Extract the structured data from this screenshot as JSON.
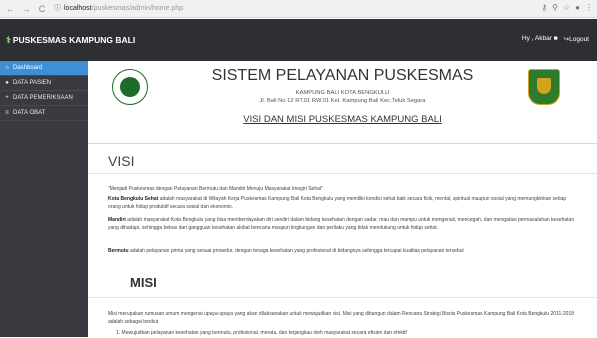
{
  "browser": {
    "url_host": "localhost",
    "url_path": "/puskesmas/admin/home.php"
  },
  "header": {
    "brand": "PUSKESMAS KAMPUNG BALI",
    "user": "Hy , Akbar",
    "logout": "Logout"
  },
  "sidebar": {
    "items": [
      {
        "label": "Dashboard",
        "icon": "home-icon"
      },
      {
        "label": "DATA PASIEN",
        "icon": "user-icon"
      },
      {
        "label": "DATA PEMERIKSAAN",
        "icon": "plus-icon"
      },
      {
        "label": "DATA OBAT",
        "icon": "list-icon"
      }
    ]
  },
  "main": {
    "title": "SISTEM PELAYANAN PUSKESMAS",
    "subtitle1": "KAMPUNG BALI KOTA BENGKULU",
    "subtitle2": "Jl. Bali No 12 RT.01 RW.01 Kel. Kampung Bali Kec.Teluk Segara",
    "visi_misi_title": "VISI DAN MISI PUSKESMAS KAMPUNG BALI",
    "visi_heading": "VISI",
    "visi_quote": "\"Menjadi Puskesmas dengan Pelayanan Bermutu dan Mandiri Menuju Masyarakat Imogiri Sehat\"",
    "kota_label": "Kota Bengkulu Sehat",
    "kota_text": "adalah masyarakat di Wilayah Kerja Puskesmas Kampung Bali Kota Bengkulu yang memiliki kondisi sehat baik secara fisik, mental, spiritual maupun sosial yang memungkinkan setiap orang untuk hidup produktif secara sosial dan ekonomis.",
    "mandiri_label": "Mandiri",
    "mandiri_text": "adalah masyarakat Kota Bengkulu yang bisa memberdayakan diri sendiri dalam bidang kesehatan dengan sadar, mau dan mampu untuk mengenali, mencegah, dan mengatasi permasalahan kesehatan yang dihadapi, sehingga bebas dari gangguan kesehatan akibat bencana maupun lingkungan dan perilaku yang tidak mendukung untuk hidup sehat.",
    "bermutu_label": "Bermutu",
    "bermutu_text": "adalah pelayanan prima yang sesuai prosedur, dengan tenaga kesehatan yang profesional di bidangnya sehingga tercapai kualitas pelayanan tersebut",
    "misi_heading": "MISI",
    "misi_text": "Misi merupakan rumusan umum mengenai upaya-upaya yang akan dilaksanakan untuk mewujudkan visi. Misi yang dibangun dalam Rencana Strategi Bisnis Puskesmas Kampung Bali Kota Bengkulu 2011-2018 adalah sebagai berikut",
    "misi_item1": "1.  Mewujudkan pelayanan kesehatan yang bermutu, profesional, merata, dan terjangkau oleh masyarakat secara efisien dan efektif"
  }
}
